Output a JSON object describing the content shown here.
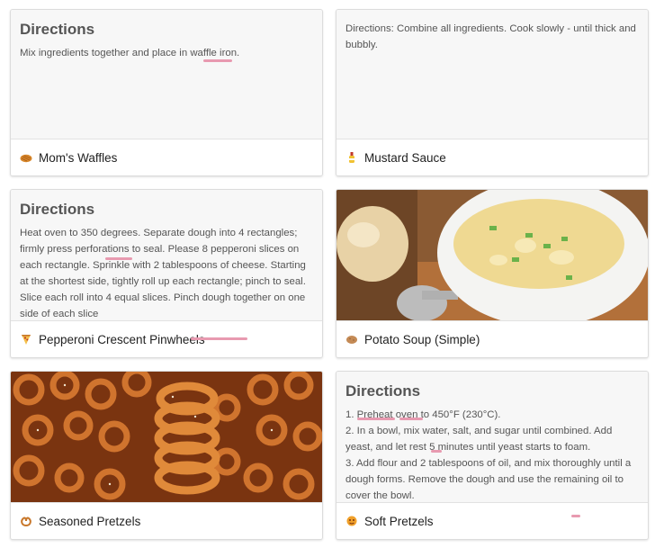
{
  "cards": [
    {
      "heading": "Directions",
      "body": "Mix ingredients together and place in waffle iron.",
      "title": "Mom's Waffles",
      "icon": "waffle-icon"
    },
    {
      "body": "Directions: Combine all ingredients. Cook slowly - until thick and bubbly.",
      "title": "Mustard Sauce",
      "icon": "mustard-icon"
    },
    {
      "heading": "Directions",
      "body": "Heat oven to 350 degrees. Separate dough into 4 rectangles; firmly press perforations to seal. Please 8 pepperoni slices on each rectangle. Sprinkle with 2 tablespoons of cheese. Starting at the shortest side, tightly roll up each rectangle; pinch to seal. Slice each roll into 4 equal slices. Pinch dough together on one side of each slice",
      "title": "Pepperoni Crescent Pinwheels",
      "icon": "pizza-icon"
    },
    {
      "title": "Potato Soup (Simple)",
      "icon": "potato-icon",
      "image": "potato-soup-photo"
    },
    {
      "title": "Seasoned Pretzels",
      "icon": "pretzel-icon",
      "image": "pretzels-photo"
    },
    {
      "heading": "Directions",
      "lines": [
        "1. Preheat oven to 450°F (230°C).",
        "2. In a bowl, mix water, salt, and sugar until combined. Add yeast, and let rest 5 minutes until yeast starts to foam.",
        "3. Add flour and 2 tablespoons of oil, and mix thoroughly until a dough forms. Remove the dough and use the remaining oil to cover the bowl."
      ],
      "title": "Soft Pretzels",
      "icon": "pretzel-face-icon"
    }
  ],
  "colors": {
    "accent_underline": "#e89ab0",
    "card_bg": "#f7f7f7"
  }
}
